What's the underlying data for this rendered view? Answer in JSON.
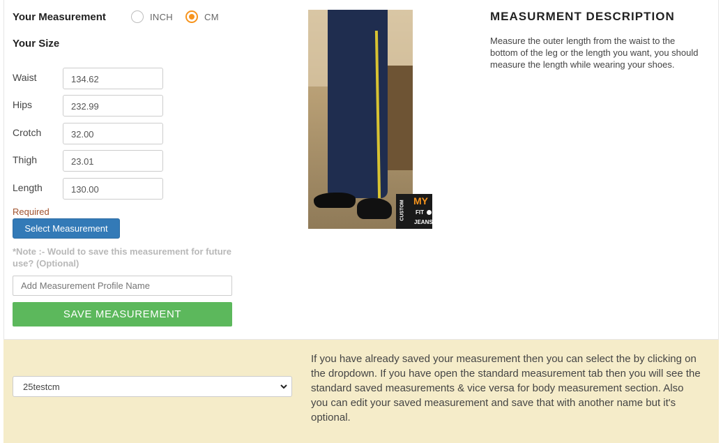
{
  "measurement": {
    "title": "Your Measurement",
    "units": [
      {
        "label": "INCH",
        "selected": false
      },
      {
        "label": "CM",
        "selected": true
      }
    ],
    "accent_color": "#f7941d"
  },
  "size": {
    "title": "Your Size",
    "fields": [
      {
        "label": "Waist",
        "value": "134.62"
      },
      {
        "label": "Hips",
        "value": "232.99"
      },
      {
        "label": "Crotch",
        "value": "32.00"
      },
      {
        "label": "Thigh",
        "value": "23.01"
      },
      {
        "label": "Length",
        "value": "130.00"
      }
    ],
    "required_text": "Required",
    "select_button": "Select Measurement"
  },
  "save": {
    "note": "*Note :- Would to save this measurement for future use? (Optional)",
    "profile_placeholder": "Add Measurement Profile Name",
    "save_button": "SAVE MEASUREMENT"
  },
  "image": {
    "logo_my": "MY",
    "logo_fit": "FIT",
    "logo_jeans": "JEANS",
    "logo_custom": "CUSTOM"
  },
  "description": {
    "title": "MEASURMENT DESCRIPTION",
    "text": "Measure the outer length from the waist to the bottom of the leg or the length you want, you should measure the length while wearing your shoes."
  },
  "saved": {
    "dropdown_value": "25testcm",
    "help_text": "If you have already saved your measurement then you can select the by clicking on the dropdown. If you have open the standard measurement tab then you will see the standard saved measurements & vice versa for body measurement section. Also you can edit your saved measurement and save that with another name but it's optional."
  },
  "colors": {
    "primary_button": "#337ab7",
    "save_button": "#5cb85c",
    "bottom_background": "#f5ecc9"
  }
}
